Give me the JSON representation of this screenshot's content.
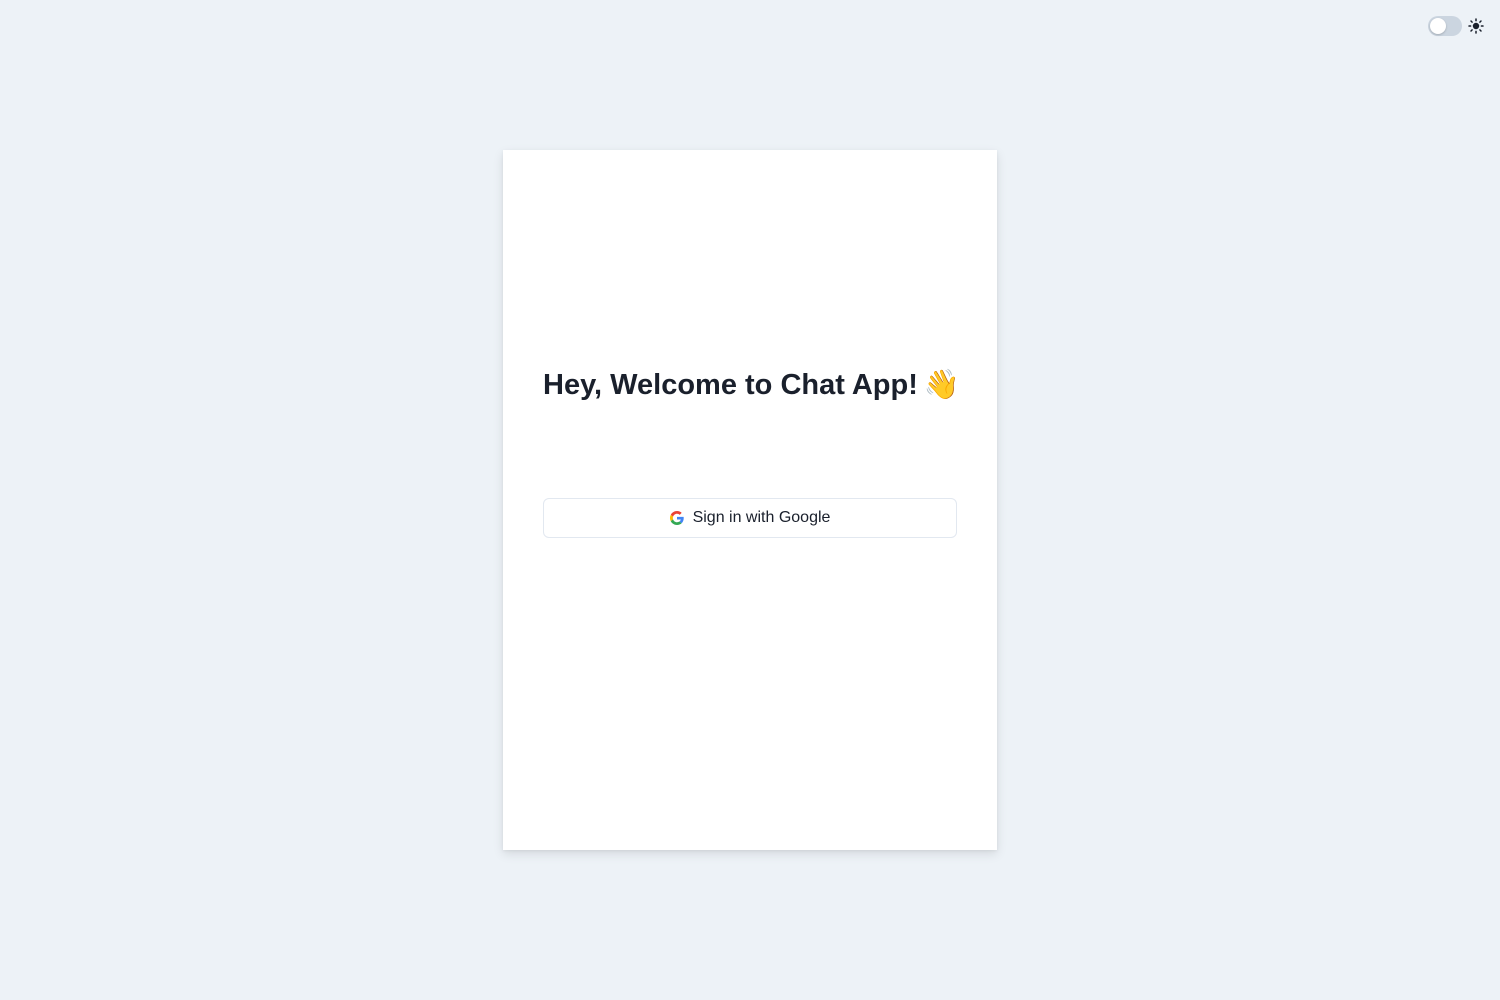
{
  "theme": {
    "dark_mode_enabled": false,
    "toggle_icon": "sun-icon"
  },
  "card": {
    "welcome_text": "Hey, Welcome to Chat App!",
    "welcome_emoji": "👋"
  },
  "signin": {
    "label": "Sign in with Google",
    "icon": "google-icon"
  },
  "colors": {
    "background": "#edf2f7",
    "card": "#ffffff",
    "text": "#1a202c",
    "border": "#e2e8f0",
    "toggle_track": "#cbd5e0"
  }
}
